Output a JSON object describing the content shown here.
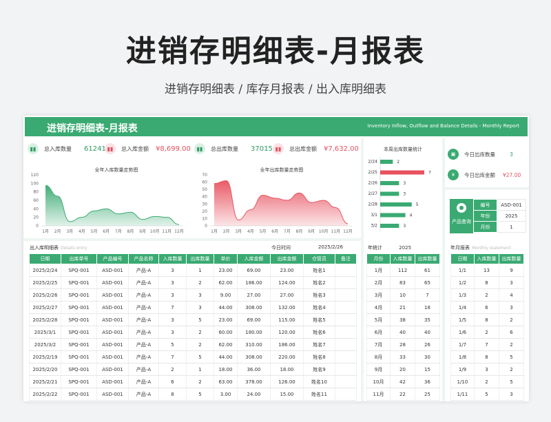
{
  "hero": {
    "title": "进销存明细表-月报表",
    "subtitle": "进销存明细表 / 库存月报表 / 出入库明细表"
  },
  "banner": {
    "title": "进销存明细表-月报表",
    "subtitle": "Inventory Inflow, Outflow and Balance Details - Monthly Report"
  },
  "kpis": [
    {
      "label": "总入库数量",
      "value": "61241"
    },
    {
      "label": "总入库金额",
      "value": "¥8,699.00"
    },
    {
      "label": "总出库数量",
      "value": "37015"
    },
    {
      "label": "总出库金额",
      "value": "¥7,632.00"
    }
  ],
  "chart_data": [
    {
      "type": "area",
      "title": "全年入库数量走势图",
      "categories": [
        "1月",
        "2月",
        "3月",
        "4月",
        "5月",
        "6月",
        "7月",
        "8月",
        "9月",
        "10月",
        "11月",
        "12月"
      ],
      "values": [
        95,
        70,
        10,
        20,
        35,
        40,
        28,
        32,
        15,
        22,
        20,
        3
      ],
      "ylim": [
        0,
        120
      ],
      "yticks": [
        0,
        20,
        40,
        60,
        80,
        100,
        120
      ],
      "color": "#3aaa72"
    },
    {
      "type": "area",
      "title": "全年出库数量走势图",
      "categories": [
        "1月",
        "2月",
        "3月",
        "4月",
        "5月",
        "6月",
        "7月",
        "8月",
        "9月",
        "10月",
        "11月",
        "12月"
      ],
      "values": [
        58,
        62,
        8,
        22,
        42,
        38,
        35,
        45,
        32,
        35,
        25,
        3
      ],
      "ylim": [
        0,
        70
      ],
      "yticks": [
        0,
        10,
        20,
        30,
        40,
        50,
        60,
        70
      ],
      "color": "#e8525f"
    },
    {
      "type": "bar",
      "title": "本周出库数量统计",
      "categories": [
        "2/24",
        "2/25",
        "2/26",
        "2/27",
        "2/28",
        "3/1",
        "3/2"
      ],
      "values": [
        2,
        7,
        3,
        3,
        5,
        4,
        3
      ],
      "highlight": "2/25",
      "color": "#3aaa72",
      "highlight_color": "#e8525f"
    }
  ],
  "today": [
    {
      "label": "今日出库数量",
      "value": "3"
    },
    {
      "label": "今日出库金额",
      "value": "¥27.00"
    }
  ],
  "product_query": {
    "label": "产品查询",
    "rows": [
      [
        "编号",
        "ASD-001"
      ],
      [
        "年份",
        "2025"
      ],
      [
        "月份",
        "1"
      ]
    ]
  },
  "detail": {
    "title": "出入库明细表",
    "title_en": "Details entry",
    "date_label": "今日时间",
    "date_value": "2025/2/26",
    "headers": [
      "日期",
      "出库单号",
      "产品编号",
      "产品名称",
      "入库数量",
      "出库数量",
      "单价",
      "入库金额",
      "出库金额",
      "仓管员",
      "备注"
    ],
    "rows": [
      [
        "2025/2/24",
        "SPQ-001",
        "ASD-001",
        "产品-A",
        "3",
        "1",
        "23.00",
        "69.00",
        "23.00",
        "姓名1",
        ""
      ],
      [
        "2025/2/25",
        "SPQ-001",
        "ASD-001",
        "产品-A",
        "3",
        "2",
        "62.00",
        "186.00",
        "124.00",
        "姓名2",
        ""
      ],
      [
        "2025/2/26",
        "SPQ-001",
        "ASD-001",
        "产品-A",
        "3",
        "3",
        "9.00",
        "27.00",
        "27.00",
        "姓名3",
        ""
      ],
      [
        "2025/2/27",
        "SPQ-001",
        "ASD-001",
        "产品-A",
        "7",
        "3",
        "44.00",
        "308.00",
        "132.00",
        "姓名4",
        ""
      ],
      [
        "2025/2/28",
        "SPQ-001",
        "ASD-001",
        "产品-A",
        "3",
        "5",
        "23.00",
        "69.00",
        "115.00",
        "姓名5",
        ""
      ],
      [
        "2025/3/1",
        "SPQ-001",
        "ASD-001",
        "产品-A",
        "3",
        "2",
        "60.00",
        "180.00",
        "120.00",
        "姓名6",
        ""
      ],
      [
        "2025/3/2",
        "SPQ-001",
        "ASD-001",
        "产品-A",
        "5",
        "2",
        "62.00",
        "310.00",
        "186.00",
        "姓名7",
        ""
      ],
      [
        "2025/2/19",
        "SPQ-001",
        "ASD-001",
        "产品-A",
        "7",
        "5",
        "44.00",
        "308.00",
        "220.00",
        "姓名8",
        ""
      ],
      [
        "2025/2/20",
        "SPQ-001",
        "ASD-001",
        "产品-A",
        "2",
        "1",
        "18.00",
        "36.00",
        "18.00",
        "姓名9",
        ""
      ],
      [
        "2025/2/21",
        "SPQ-001",
        "ASD-001",
        "产品-A",
        "6",
        "2",
        "63.00",
        "378.00",
        "126.00",
        "姓名10",
        ""
      ],
      [
        "2025/2/22",
        "SPQ-001",
        "ASD-001",
        "产品-A",
        "8",
        "5",
        "3.00",
        "24.00",
        "15.00",
        "姓名11",
        ""
      ]
    ]
  },
  "year_stats": {
    "title": "年统计",
    "year": "2025",
    "headers": [
      "月份",
      "入库数量",
      "出库数量"
    ],
    "rows": [
      [
        "1月",
        "112",
        "61"
      ],
      [
        "2月",
        "83",
        "65"
      ],
      [
        "3月",
        "10",
        "7"
      ],
      [
        "4月",
        "21",
        "18"
      ],
      [
        "5月",
        "38",
        "35"
      ],
      [
        "6月",
        "40",
        "40"
      ],
      [
        "7月",
        "28",
        "26"
      ],
      [
        "8月",
        "33",
        "30"
      ],
      [
        "9月",
        "20",
        "15"
      ],
      [
        "10月",
        "42",
        "36"
      ],
      [
        "11月",
        "22",
        "25"
      ]
    ]
  },
  "month_report": {
    "title": "年月报表",
    "title_en": "Monthly statement",
    "headers": [
      "日期",
      "入库数量",
      "出库数量"
    ],
    "rows": [
      [
        "1/1",
        "13",
        "9"
      ],
      [
        "1/2",
        "8",
        "3"
      ],
      [
        "1/3",
        "2",
        "4"
      ],
      [
        "1/4",
        "6",
        "3"
      ],
      [
        "1/5",
        "8",
        "2"
      ],
      [
        "1/6",
        "2",
        "6"
      ],
      [
        "1/7",
        "7",
        "2"
      ],
      [
        "1/8",
        "8",
        "5"
      ],
      [
        "1/9",
        "3",
        "2"
      ],
      [
        "1/10",
        "2",
        "5"
      ],
      [
        "1/11",
        "5",
        "3"
      ]
    ]
  }
}
